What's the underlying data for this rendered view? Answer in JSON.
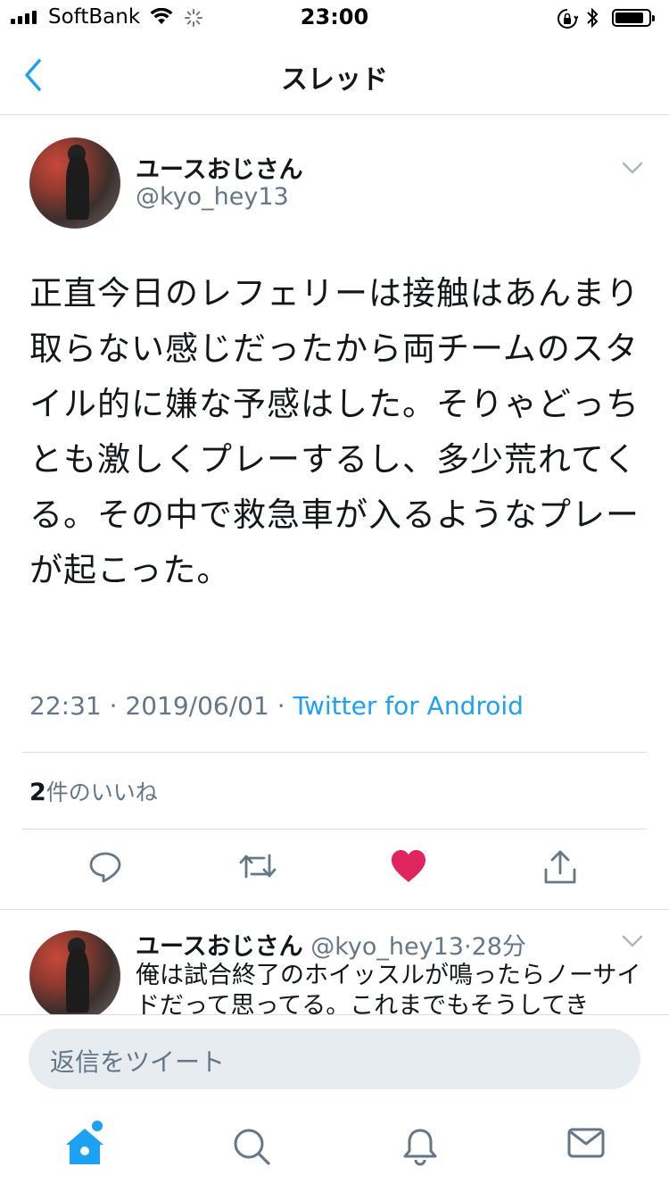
{
  "status_bar": {
    "carrier": "SoftBank",
    "time": "23:00",
    "battery_level": 0.85,
    "icons": [
      "signal-icon",
      "wifi-icon",
      "activity-spinner-icon",
      "orientation-lock-icon",
      "bluetooth-icon",
      "battery-icon"
    ]
  },
  "nav": {
    "title": "スレッド",
    "back_icon": "chevron-left-icon"
  },
  "tweet": {
    "name": "ユースおじさん",
    "handle": "@kyo_hey13",
    "text": "正直今日のレフェリーは接触はあんまり取らない感じだったから両チームのスタイル的に嫌な予感はした。そりゃどっちとも激しくプレーするし、多少荒れてくる。その中で救急車が入るようなプレーが起こった。",
    "time": "22:31",
    "date": "2019/06/01",
    "separator": "·",
    "source": "Twitter for Android",
    "likes_count": "2",
    "likes_label": "件のいいね",
    "liked": true,
    "colors": {
      "accent": "#1da1f2",
      "like": "#e0245e",
      "secondary_text": "#657786"
    }
  },
  "reply": {
    "name": "ユースおじさん",
    "handle": "@kyo_hey13",
    "separator": "·",
    "time_ago": "28分",
    "text": "俺は試合終了のホイッスルが鳴ったらノーサイドだって思ってる。これまでもそうしてき"
  },
  "composer": {
    "placeholder": "返信をツイート"
  },
  "tabs": [
    "home-icon",
    "search-icon",
    "notifications-bell-icon",
    "messages-envelope-icon"
  ]
}
